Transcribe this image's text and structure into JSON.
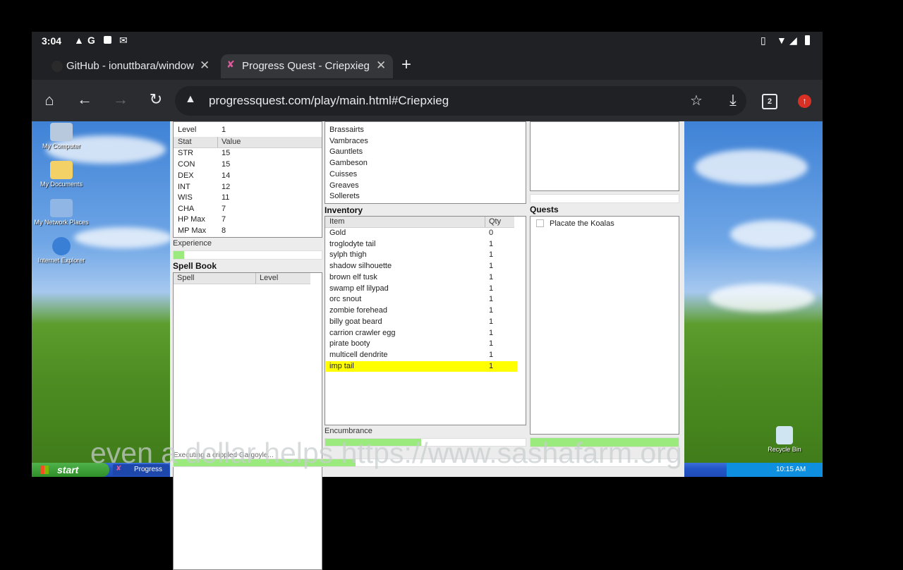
{
  "status_bar": {
    "time": "3:04"
  },
  "tabs": [
    {
      "title": "GitHub - ionuttbara/window",
      "active": false
    },
    {
      "title": "Progress Quest - Criepxieg",
      "active": true
    }
  ],
  "new_tab_symbol": "+",
  "toolbar": {
    "url": "progressquest.com/play/main.html#Criepxieg",
    "tab_count": "2"
  },
  "desktop": {
    "icons": [
      "My Computer",
      "My Documents",
      "My Network Places",
      "Internet Explorer",
      "Recycle Bin"
    ],
    "taskbar": {
      "start_label": "start",
      "task_label": "Progress",
      "clock": "10:15 AM"
    }
  },
  "character": {
    "level_label": "Level",
    "level_value": "1",
    "stats_header": {
      "col1": "Stat",
      "col2": "Value"
    },
    "stats": [
      {
        "name": "STR",
        "value": "15"
      },
      {
        "name": "CON",
        "value": "15"
      },
      {
        "name": "DEX",
        "value": "14"
      },
      {
        "name": "INT",
        "value": "12"
      },
      {
        "name": "WIS",
        "value": "11"
      },
      {
        "name": "CHA",
        "value": "7"
      },
      {
        "name": "HP Max",
        "value": "7"
      },
      {
        "name": "MP Max",
        "value": "8"
      }
    ],
    "experience_label": "Experience",
    "experience_progress": 0.07
  },
  "spell_book": {
    "title": "Spell Book",
    "header": {
      "col1": "Spell",
      "col2": "Level"
    }
  },
  "equipment": {
    "items": [
      "Brassairts",
      "Vambraces",
      "Gauntlets",
      "Gambeson",
      "Cuisses",
      "Greaves",
      "Sollerets"
    ]
  },
  "inventory": {
    "title": "Inventory",
    "header": {
      "col1": "Item",
      "col2": "Qty"
    },
    "items": [
      {
        "name": "Gold",
        "qty": "0"
      },
      {
        "name": "troglodyte tail",
        "qty": "1"
      },
      {
        "name": "sylph thigh",
        "qty": "1"
      },
      {
        "name": "shadow silhouette",
        "qty": "1"
      },
      {
        "name": "brown elf tusk",
        "qty": "1"
      },
      {
        "name": "swamp elf lilypad",
        "qty": "1"
      },
      {
        "name": "orc snout",
        "qty": "1"
      },
      {
        "name": "zombie forehead",
        "qty": "1"
      },
      {
        "name": "billy goat beard",
        "qty": "1"
      },
      {
        "name": "carrion crawler egg",
        "qty": "1"
      },
      {
        "name": "pirate booty",
        "qty": "1"
      },
      {
        "name": "multicell dendrite",
        "qty": "1"
      },
      {
        "name": "imp tail",
        "qty": "1"
      }
    ],
    "highlight_color": "#ffff00",
    "encumbrance_label": "Encumbrance",
    "encumbrance_progress": 0.48
  },
  "quests": {
    "title": "Quests",
    "items": [
      "Placate the Koalas"
    ],
    "progress": 1.0
  },
  "status_text": "Executing a crippled Gargoyle...",
  "overlay_text": "even a dollar helps https://www.sashafarm.org",
  "colors": {
    "progress_fill": "#9bea7e",
    "browser_bg": "#202124"
  }
}
